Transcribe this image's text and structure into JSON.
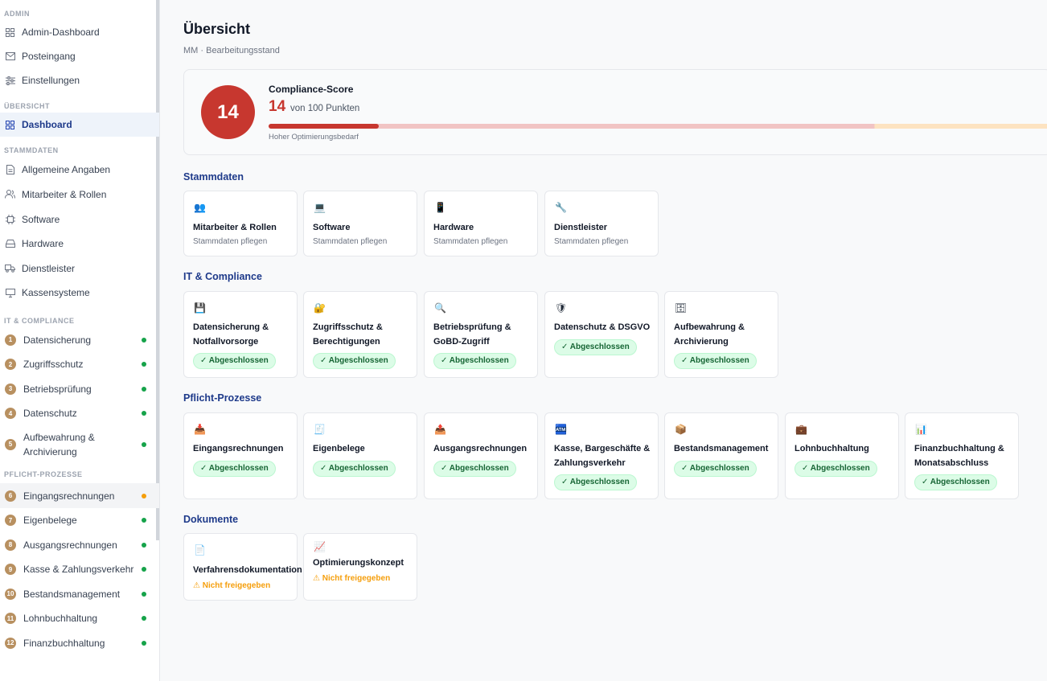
{
  "sidebar": {
    "admin_head": "ADMIN",
    "admin_items": [
      "Admin-Dashboard",
      "Posteingang",
      "Einstellungen"
    ],
    "overview_head": "ÜBERSICHT",
    "dashboard": "Dashboard",
    "stamm_head": "STAMMDATEN",
    "stamm_items": [
      "Allgemeine Angaben",
      "Mitarbeiter & Rollen",
      "Software",
      "Hardware",
      "Dienstleister",
      "Kassensysteme"
    ],
    "itc_head": "IT & COMPLIANCE",
    "itc_items": [
      {
        "num": "1",
        "label": "Datensicherung"
      },
      {
        "num": "2",
        "label": "Zugriffsschutz"
      },
      {
        "num": "3",
        "label": "Betriebsprüfung"
      },
      {
        "num": "4",
        "label": "Datenschutz"
      },
      {
        "num": "5",
        "label": "Aufbewahrung &",
        "label2": "Archivierung"
      }
    ],
    "pp_head": "PFLICHT-PROZESSE",
    "pp_items": [
      {
        "num": "6",
        "label": "Eingangsrechnungen"
      },
      {
        "num": "7",
        "label": "Eigenbelege"
      },
      {
        "num": "8",
        "label": "Ausgangsrechnungen"
      },
      {
        "num": "9",
        "label": "Kasse & Zahlungsverkehr"
      },
      {
        "num": "10",
        "label": "Bestandsmanagement"
      },
      {
        "num": "11",
        "label": "Lohnbuchhaltung"
      },
      {
        "num": "12",
        "label": "Finanzbuchhaltung"
      }
    ]
  },
  "header": {
    "title": "Übersicht",
    "subtitle": "MM · Bearbeitungsstand"
  },
  "score": {
    "label": "Compliance-Score",
    "value": "14",
    "of": "von 100 Punkten",
    "percent": 14,
    "note": "Hoher Optimierungsbedarf"
  },
  "sections": {
    "stamm": {
      "title": "Stammdaten",
      "cards": [
        {
          "icon": "👥",
          "title": "Mitarbeiter & Rollen",
          "sub": "Stammdaten pflegen"
        },
        {
          "icon": "💻",
          "title": "Software",
          "sub": "Stammdaten pflegen"
        },
        {
          "icon": "📱",
          "title": "Hardware",
          "sub": "Stammdaten pflegen"
        },
        {
          "icon": "🔧",
          "title": "Dienstleister",
          "sub": "Stammdaten pflegen"
        }
      ]
    },
    "itc": {
      "title": "IT & Compliance",
      "cards": [
        {
          "icon": "💾",
          "title": "Datensicherung & Notfallvorsorge",
          "badge": "✓ Abgeschlossen"
        },
        {
          "icon": "🔐",
          "title": "Zugriffsschutz & Berechtigungen",
          "badge": "✓ Abgeschlossen"
        },
        {
          "icon": "🔍",
          "title": "Betriebsprüfung & GoBD-Zugriff",
          "badge": "✓ Abgeschlossen"
        },
        {
          "icon": "🛡",
          "title": "Datenschutz & DSGVO",
          "badge": "✓ Abgeschlossen"
        },
        {
          "icon": "🗄",
          "title": "Aufbewahrung & Archivierung",
          "badge": "✓ Abgeschlossen"
        }
      ]
    },
    "pp": {
      "title": "Pflicht-Prozesse",
      "cards": [
        {
          "icon": "📥",
          "title": "Eingangsrechnungen",
          "badge": "✓ Abgeschlossen"
        },
        {
          "icon": "🧾",
          "title": "Eigenbelege",
          "badge": "✓ Abgeschlossen"
        },
        {
          "icon": "📤",
          "title": "Ausgangsrechnungen",
          "badge": "✓ Abgeschlossen"
        },
        {
          "icon": "🏧",
          "title": "Kasse, Bargeschäfte & Zahlungsverkehr",
          "badge": "✓ Abgeschlossen"
        },
        {
          "icon": "📦",
          "title": "Bestandsmanagement",
          "badge": "✓ Abgeschlossen"
        },
        {
          "icon": "💼",
          "title": "Lohnbuchhaltung",
          "badge": "✓ Abgeschlossen"
        },
        {
          "icon": "📊",
          "title": "Finanzbuchhaltung & Monatsabschluss",
          "badge": "✓ Abgeschlossen"
        }
      ]
    },
    "docs": {
      "title": "Dokumente",
      "cards": [
        {
          "icon": "📄",
          "title": "Verfahrensdokumentation",
          "warn": "⚠ Nicht freigegeben"
        },
        {
          "icon": "📈",
          "title": "Optimierungskonzept",
          "warn": "⚠ Nicht freigegeben"
        }
      ]
    }
  }
}
